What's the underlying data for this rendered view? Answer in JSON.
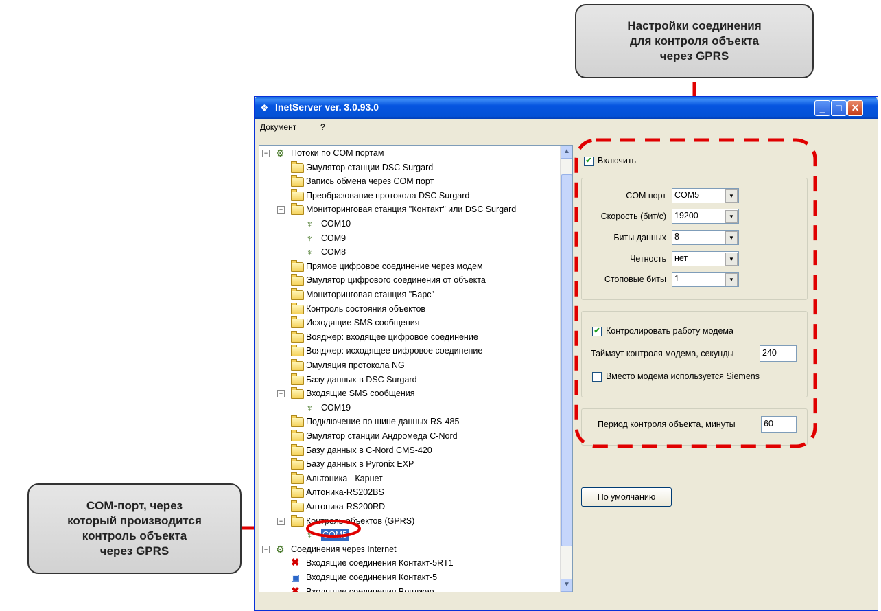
{
  "callouts": {
    "top": "Настройки соединения\nдля контроля объекта\nчерез GPRS",
    "left": "COM-порт, через\nкоторый производится\nконтроль объекта\nчерез GPRS"
  },
  "window": {
    "title": "InetServer ver. 3.0.93.0",
    "controls": {
      "minimize": "_",
      "maximize": "□",
      "close": "✕"
    }
  },
  "menu": [
    "Документ",
    "?"
  ],
  "tree": [
    {
      "label": "Потоки по COM портам",
      "icon": "plug-icon",
      "level": 0,
      "expander": "−"
    },
    {
      "label": "Эмулятор станции DSC Surgard",
      "icon": "folder-icon",
      "level": 1
    },
    {
      "label": "Запись обмена через COM порт",
      "icon": "folder-icon",
      "level": 1
    },
    {
      "label": "Преобразование протокола DSC Surgard",
      "icon": "folder-icon",
      "level": 1
    },
    {
      "label": "Мониторинговая станция \"Контакт\" или DSC Surgard",
      "icon": "folder-icon",
      "level": 1,
      "expander": "−"
    },
    {
      "label": "COM10",
      "icon": "port-icon",
      "level": 2
    },
    {
      "label": "COM9",
      "icon": "port-icon",
      "level": 2
    },
    {
      "label": "COM8",
      "icon": "port-icon",
      "level": 2
    },
    {
      "label": "Прямое цифровое соединение через модем",
      "icon": "folder-icon",
      "level": 1
    },
    {
      "label": "Эмулятор цифрового соединения от объекта",
      "icon": "folder-icon",
      "level": 1
    },
    {
      "label": "Мониторинговая станция \"Барс\"",
      "icon": "folder-icon",
      "level": 1
    },
    {
      "label": "Контроль состояния объектов",
      "icon": "folder-icon",
      "level": 1
    },
    {
      "label": "Исходящие SMS сообщения",
      "icon": "folder-icon",
      "level": 1
    },
    {
      "label": "Вояджер: входящее цифровое соединение",
      "icon": "folder-icon",
      "level": 1
    },
    {
      "label": "Вояджер: исходящее цифровое соединение",
      "icon": "folder-icon",
      "level": 1
    },
    {
      "label": "Эмуляция протокола NG",
      "icon": "folder-icon",
      "level": 1
    },
    {
      "label": "Базу данных в DSC Surgard",
      "icon": "folder-icon",
      "level": 1
    },
    {
      "label": "Входящие SMS сообщения",
      "icon": "folder-icon",
      "level": 1,
      "expander": "−"
    },
    {
      "label": "COM19",
      "icon": "port-icon",
      "level": 2
    },
    {
      "label": "Подключение по шине данных RS-485",
      "icon": "folder-icon",
      "level": 1
    },
    {
      "label": "Эмулятор станции Андромеда C-Nord",
      "icon": "folder-icon",
      "level": 1
    },
    {
      "label": "Базу данных в C-Nord CMS-420",
      "icon": "folder-icon",
      "level": 1
    },
    {
      "label": "Базу данных в Pyronix EXP",
      "icon": "folder-icon",
      "level": 1
    },
    {
      "label": "Альтоника - Карнет",
      "icon": "folder-icon",
      "level": 1
    },
    {
      "label": "Алтоника-RS202BS",
      "icon": "folder-icon",
      "level": 1
    },
    {
      "label": "Алтоника-RS200RD",
      "icon": "folder-icon",
      "level": 1
    },
    {
      "label": "Контроль объектов (GPRS)",
      "icon": "folder-icon",
      "level": 1,
      "expander": "−"
    },
    {
      "label": "COM5",
      "icon": "port-icon",
      "level": 2,
      "selected": true
    },
    {
      "label": "Соединения через Internet",
      "icon": "plug-icon",
      "level": 0,
      "expander": "−"
    },
    {
      "label": "Входящие соединения Контакт-5RT1",
      "icon": "red-x-icon",
      "level": 1
    },
    {
      "label": "Входящие соединения Контакт-5",
      "icon": "computer-icon",
      "level": 1
    },
    {
      "label": "Входящие соединения Вояджер",
      "icon": "red-x-icon",
      "level": 1
    }
  ],
  "panel": {
    "enable_label": "Включить",
    "enable_checked": true,
    "com_port_label": "COM порт",
    "com_port_value": "COM5",
    "speed_label": "Скорость (бит/с)",
    "speed_value": "19200",
    "data_bits_label": "Биты данных",
    "data_bits_value": "8",
    "parity_label": "Четность",
    "parity_value": "нет",
    "stop_bits_label": "Стоповые биты",
    "stop_bits_value": "1",
    "modem_control_label": "Контролировать работу модема",
    "modem_control_checked": true,
    "modem_timeout_label": "Таймаут контроля модема, секунды",
    "modem_timeout_value": "240",
    "siemens_label": "Вместо модема используется Siemens",
    "siemens_checked": false,
    "period_label": "Период контроля объекта, минуты",
    "period_value": "60",
    "default_button": "По умолчанию"
  },
  "colors": {
    "highlight": "#e00000",
    "selection": "#316ac5",
    "titlebar": "#0454d6"
  }
}
